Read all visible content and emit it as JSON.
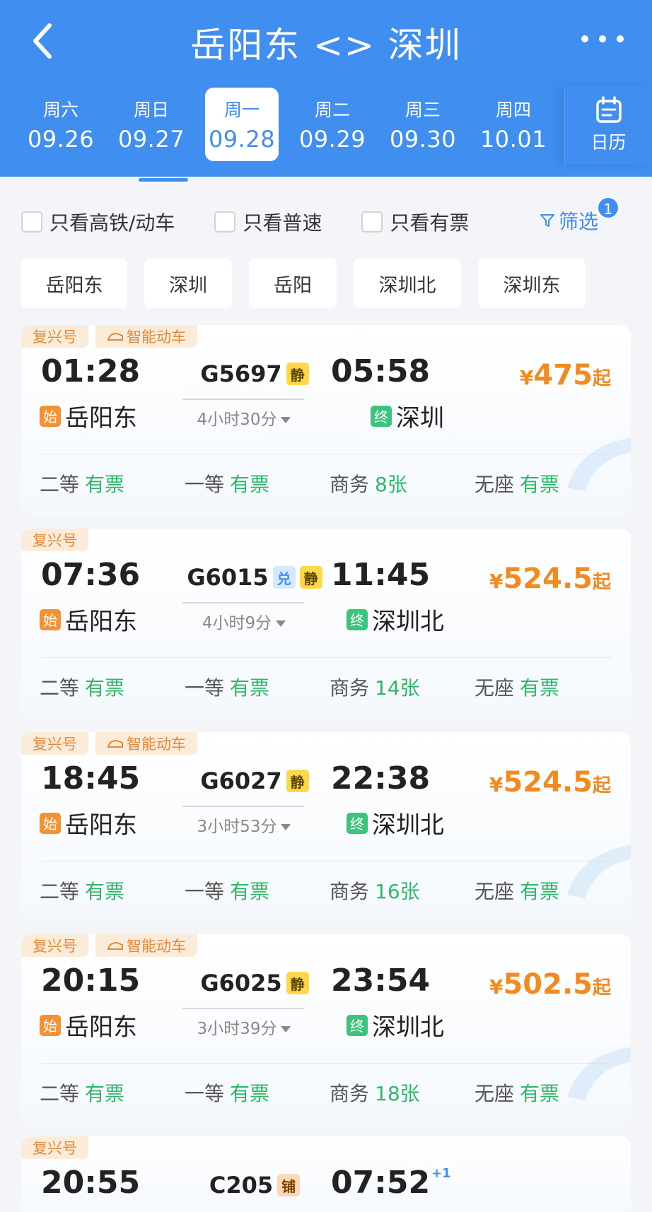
{
  "header": {
    "title": "岳阳东 <> 深圳",
    "calendar_label": "日历",
    "dates": [
      {
        "weekday": "周六",
        "date": "09.26"
      },
      {
        "weekday": "周日",
        "date": "09.27"
      },
      {
        "weekday": "周一",
        "date": "09.28"
      },
      {
        "weekday": "周二",
        "date": "09.29"
      },
      {
        "weekday": "周三",
        "date": "09.30"
      },
      {
        "weekday": "周四",
        "date": "10.01"
      }
    ]
  },
  "filters": {
    "high_speed": "只看高铁/动车",
    "normal": "只看普速",
    "available": "只看有票",
    "filter_label": "筛选",
    "filter_count": "1"
  },
  "stations": [
    "岳阳东",
    "深圳",
    "岳阳",
    "深圳北",
    "深圳东"
  ],
  "labels": {
    "start": "始",
    "end": "终",
    "currency": "¥",
    "from": "起"
  },
  "trains": [
    {
      "tags": [
        "复兴号",
        "智能动车"
      ],
      "dep_time": "01:28",
      "dep_station": "岳阳东",
      "train_no": "G5697",
      "badges": [
        "静"
      ],
      "duration": "4小时30分",
      "arr_time": "05:58",
      "arr_station": "深圳",
      "price": "475",
      "seats": [
        {
          "label": "二等",
          "avail": "有票"
        },
        {
          "label": "一等",
          "avail": "有票"
        },
        {
          "label": "商务",
          "avail": "8张"
        },
        {
          "label": "无座",
          "avail": "有票"
        }
      ]
    },
    {
      "tags": [
        "复兴号"
      ],
      "dep_time": "07:36",
      "dep_station": "岳阳东",
      "train_no": "G6015",
      "badges": [
        "兑",
        "静"
      ],
      "duration": "4小时9分",
      "arr_time": "11:45",
      "arr_station": "深圳北",
      "price": "524.5",
      "seats": [
        {
          "label": "二等",
          "avail": "有票"
        },
        {
          "label": "一等",
          "avail": "有票"
        },
        {
          "label": "商务",
          "avail": "14张"
        },
        {
          "label": "无座",
          "avail": "有票"
        }
      ]
    },
    {
      "tags": [
        "复兴号",
        "智能动车"
      ],
      "dep_time": "18:45",
      "dep_station": "岳阳东",
      "train_no": "G6027",
      "badges": [
        "静"
      ],
      "duration": "3小时53分",
      "arr_time": "22:38",
      "arr_station": "深圳北",
      "price": "524.5",
      "seats": [
        {
          "label": "二等",
          "avail": "有票"
        },
        {
          "label": "一等",
          "avail": "有票"
        },
        {
          "label": "商务",
          "avail": "16张"
        },
        {
          "label": "无座",
          "avail": "有票"
        }
      ]
    },
    {
      "tags": [
        "复兴号",
        "智能动车"
      ],
      "dep_time": "20:15",
      "dep_station": "岳阳东",
      "train_no": "G6025",
      "badges": [
        "静"
      ],
      "duration": "3小时39分",
      "arr_time": "23:54",
      "arr_station": "深圳北",
      "price": "502.5",
      "seats": [
        {
          "label": "二等",
          "avail": "有票"
        },
        {
          "label": "一等",
          "avail": "有票"
        },
        {
          "label": "商务",
          "avail": "18张"
        },
        {
          "label": "无座",
          "avail": "有票"
        }
      ]
    },
    {
      "tags": [
        "复兴号"
      ],
      "dep_time": "20:55",
      "train_no": "C205",
      "badges": [
        "铺"
      ],
      "arr_time": "07:52",
      "arr_day_offset": "+1"
    }
  ]
}
